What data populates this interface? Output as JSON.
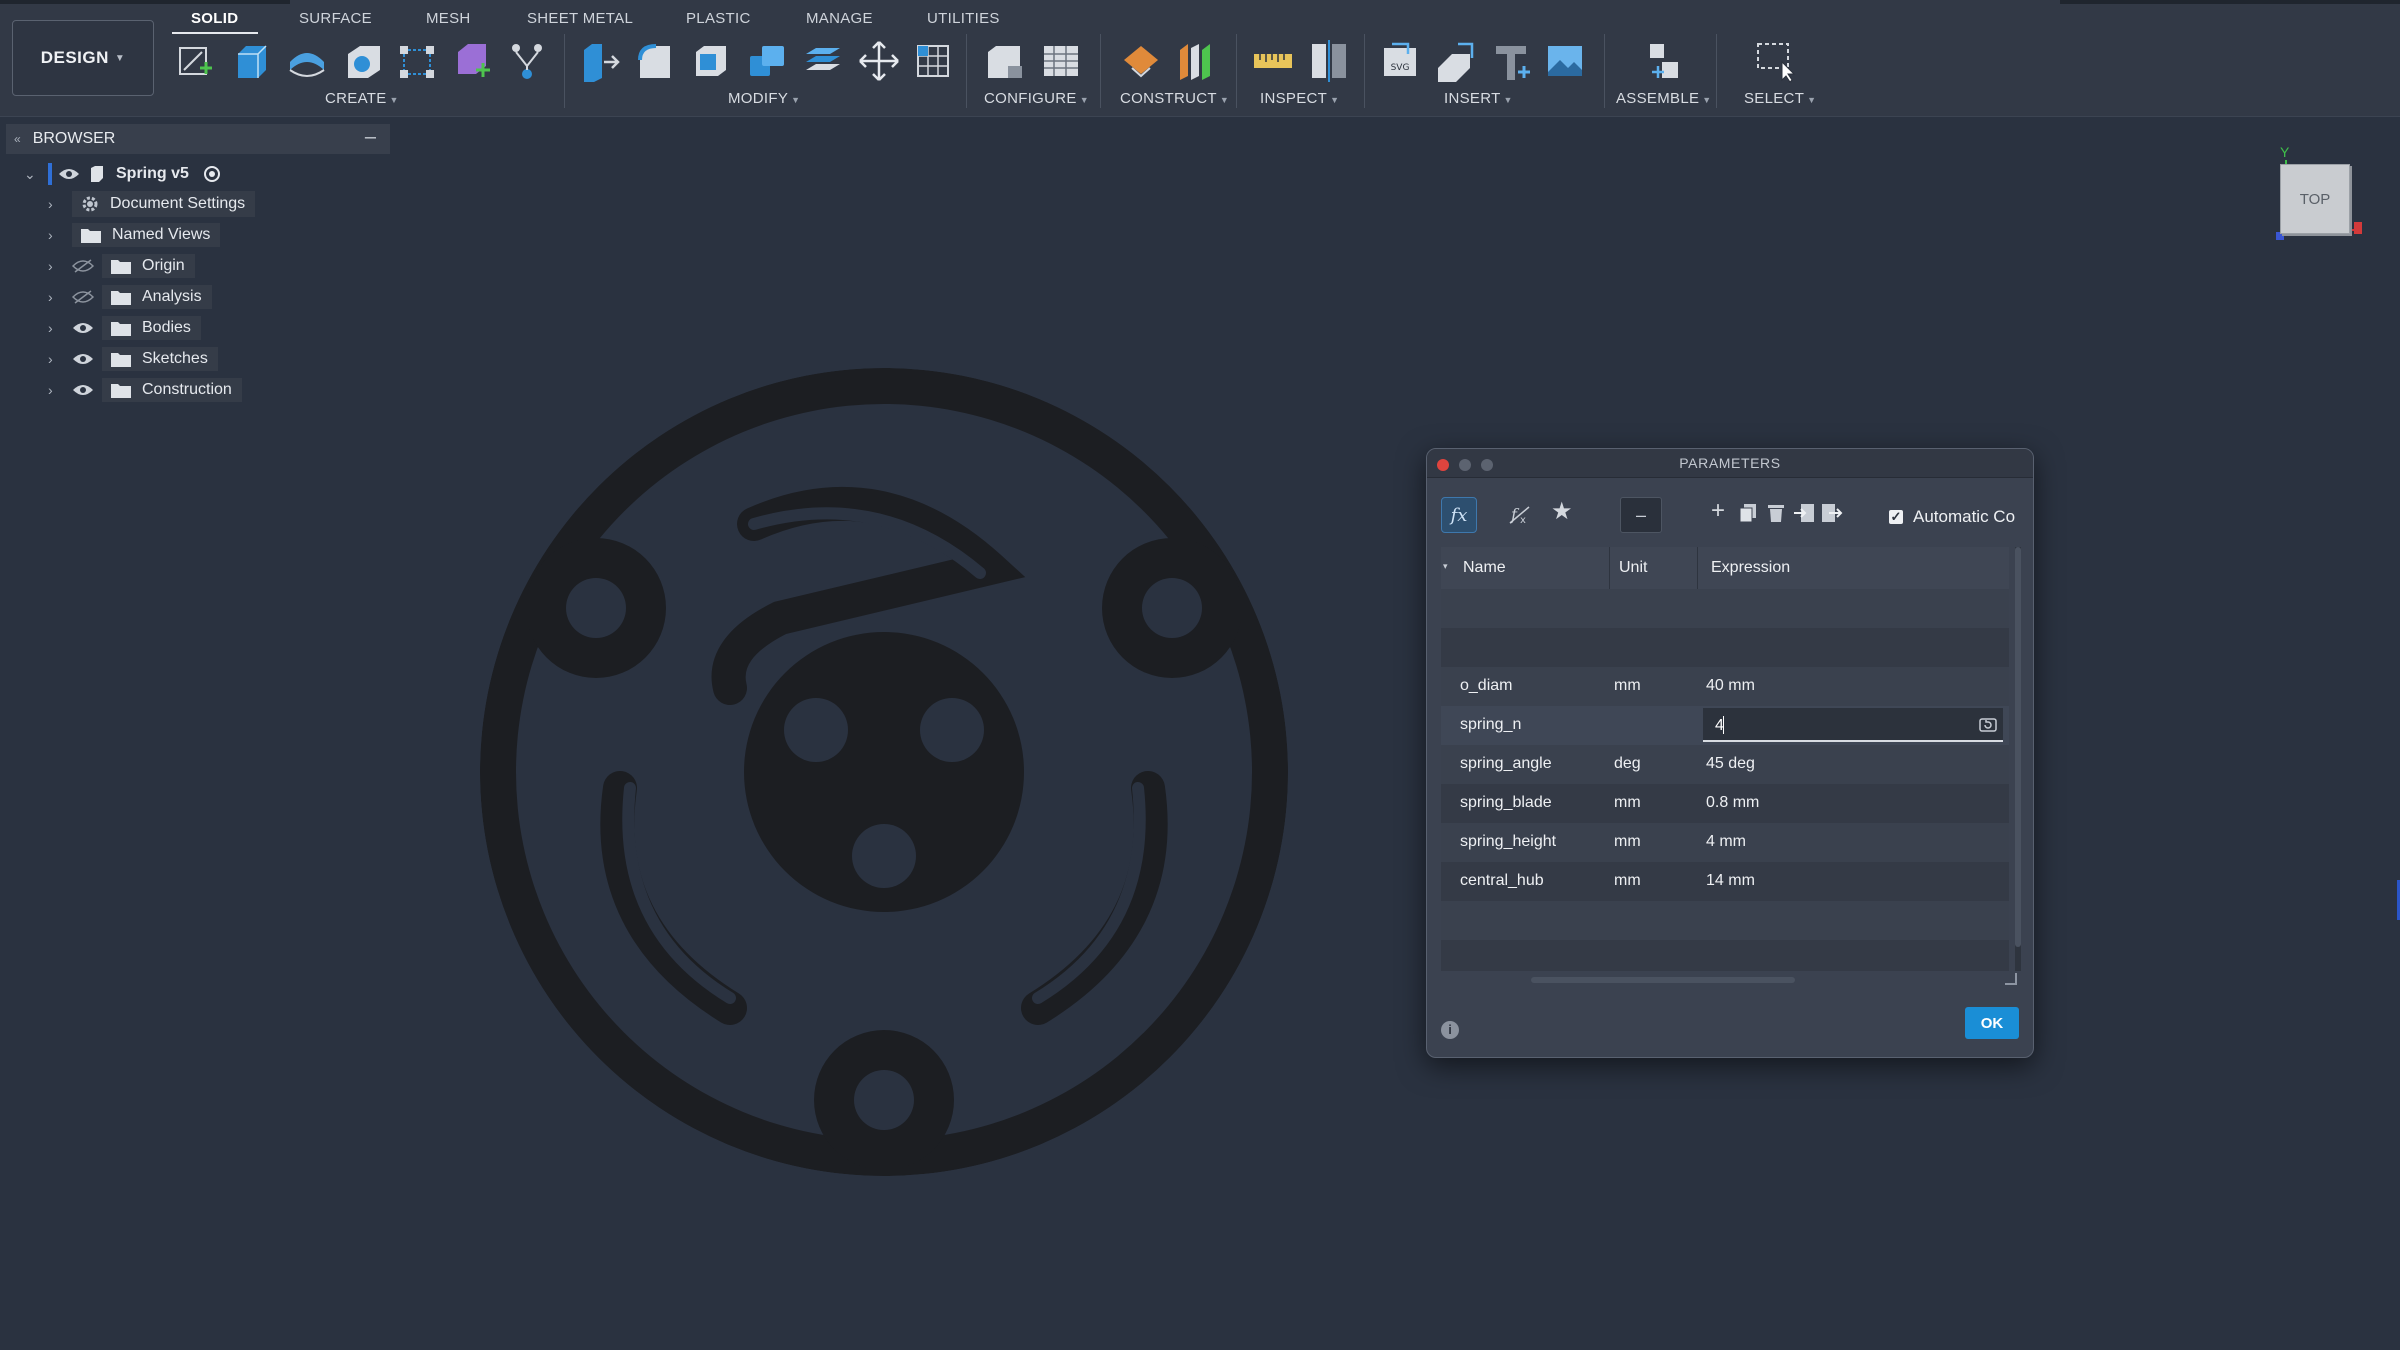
{
  "toolbar": {
    "workspace": "DESIGN",
    "tabs": [
      "SOLID",
      "SURFACE",
      "MESH",
      "SHEET METAL",
      "PLASTIC",
      "MANAGE",
      "UTILITIES"
    ],
    "groups": [
      "CREATE",
      "MODIFY",
      "CONFIGURE",
      "CONSTRUCT",
      "INSPECT",
      "INSERT",
      "ASSEMBLE",
      "SELECT"
    ]
  },
  "browser": {
    "title": "BROWSER",
    "root": "Spring v5",
    "items": [
      {
        "label": "Document Settings",
        "icon": "gear-icon"
      },
      {
        "label": "Named Views",
        "icon": "folder-icon"
      },
      {
        "label": "Origin",
        "icon": "folder-icon",
        "visibility": "hidden"
      },
      {
        "label": "Analysis",
        "icon": "folder-icon",
        "visibility": "hidden"
      },
      {
        "label": "Bodies",
        "icon": "folder-icon",
        "visibility": "visible"
      },
      {
        "label": "Sketches",
        "icon": "folder-icon",
        "visibility": "visible"
      },
      {
        "label": "Construction",
        "icon": "folder-icon",
        "visibility": "visible"
      }
    ]
  },
  "viewcube": {
    "face": "TOP",
    "axis_y": "Y"
  },
  "parameters": {
    "title": "PARAMETERS",
    "fx_label": "fx",
    "dash_label": "–",
    "auto_compute_label": "Automatic Co",
    "auto_compute_checked": true,
    "columns": [
      "Name",
      "Unit",
      "Expression"
    ],
    "rows": [
      {
        "name": "o_diam",
        "unit": "mm",
        "expression": "40 mm"
      },
      {
        "name": "spring_n",
        "unit": "",
        "expression": "4"
      },
      {
        "name": "spring_angle",
        "unit": "deg",
        "expression": "45 deg"
      },
      {
        "name": "spring_blade",
        "unit": "mm",
        "expression": "0.8 mm"
      },
      {
        "name": "spring_height",
        "unit": "mm",
        "expression": "4 mm"
      },
      {
        "name": "central_hub",
        "unit": "mm",
        "expression": "14 mm"
      }
    ],
    "info_icon": "i",
    "ok_label": "OK"
  },
  "colors": {
    "accent": "#1a8ed6",
    "background": "#2a3240",
    "part": "#1c1e22"
  }
}
